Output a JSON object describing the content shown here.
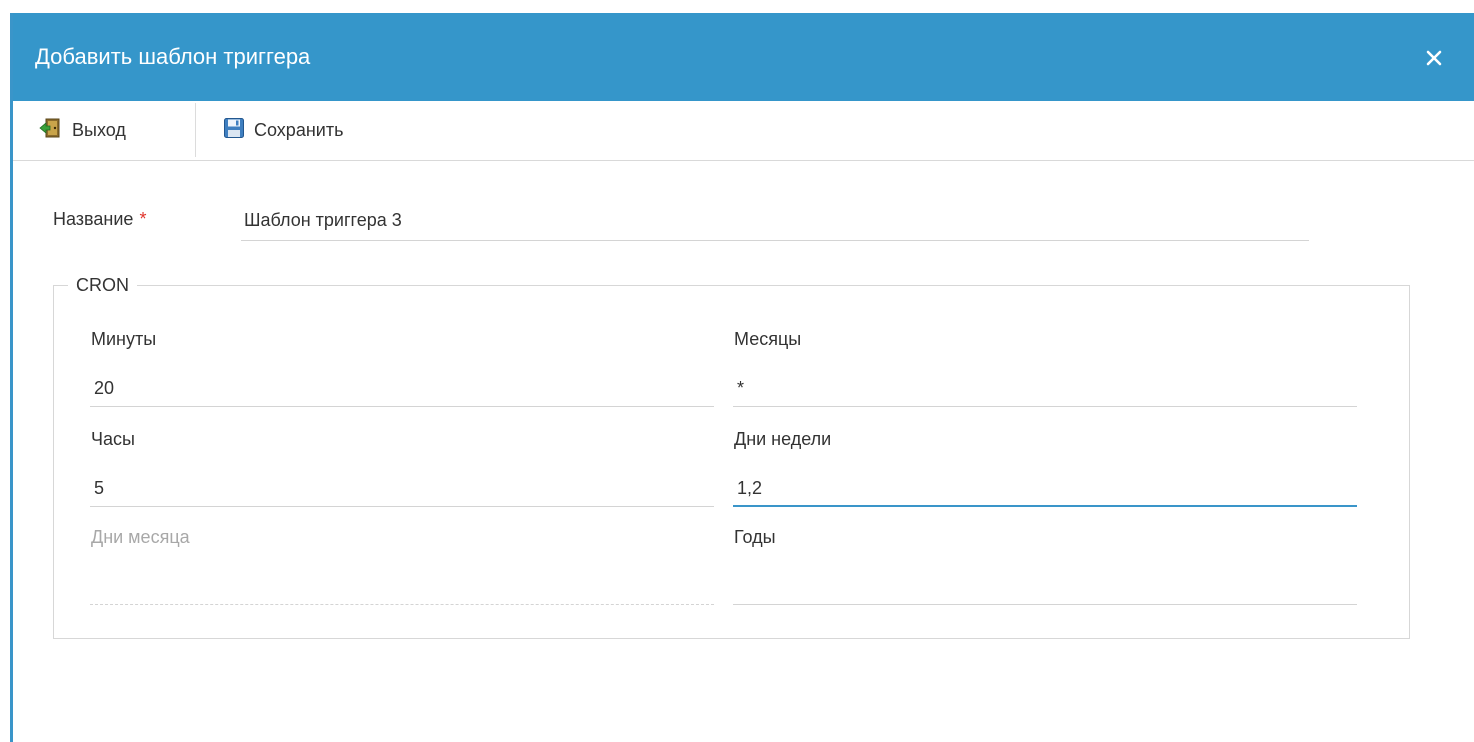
{
  "dialog": {
    "title": "Добавить шаблон триггера",
    "close_icon": "close-icon",
    "accent_color": "#3596ca"
  },
  "toolbar": {
    "exit_label": "Выход",
    "exit_icon": "exit-door-icon",
    "save_label": "Сохранить",
    "save_icon": "floppy-disk-icon"
  },
  "form": {
    "name_label": "Название",
    "required_mark": "*",
    "name_value": "Шаблон триггера 3"
  },
  "cron": {
    "legend": "CRON",
    "minutes": {
      "label": "Минуты",
      "value": "20"
    },
    "hours": {
      "label": "Часы",
      "value": "5"
    },
    "days_of_month": {
      "label": "Дни месяца",
      "value": "",
      "disabled": true
    },
    "months": {
      "label": "Месяцы",
      "value": "*"
    },
    "days_of_week": {
      "label": "Дни недели",
      "value": "1,2",
      "focused": true
    },
    "years": {
      "label": "Годы",
      "value": ""
    }
  }
}
